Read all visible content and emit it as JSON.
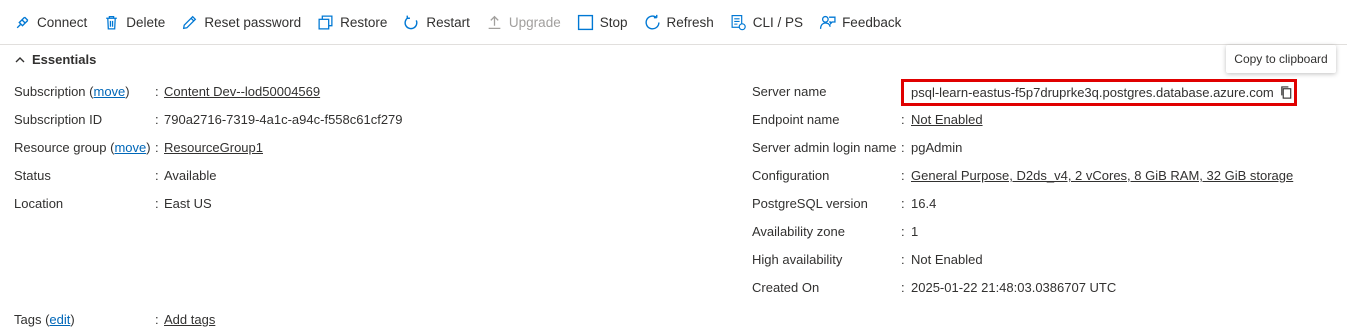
{
  "toolbar": {
    "connect": "Connect",
    "delete": "Delete",
    "reset_password": "Reset password",
    "restore": "Restore",
    "restart": "Restart",
    "upgrade": "Upgrade",
    "stop": "Stop",
    "refresh": "Refresh",
    "cli_ps": "CLI / PS",
    "feedback": "Feedback"
  },
  "essentials": {
    "title": "Essentials"
  },
  "tooltip": "Copy to clipboard",
  "left": {
    "subscription_label": "Subscription (",
    "subscription_move": "move",
    "subscription_close": ")",
    "subscription_value": "Content Dev--lod50004569",
    "subscription_id_label": "Subscription ID",
    "subscription_id_value": "790a2716-7319-4a1c-a94c-f558c61cf279",
    "resource_group_label": "Resource group (",
    "resource_group_move": "move",
    "resource_group_close": ")",
    "resource_group_value": "ResourceGroup1",
    "status_label": "Status",
    "status_value": "Available",
    "location_label": "Location",
    "location_value": "East US",
    "tags_label": "Tags (",
    "tags_edit": "edit",
    "tags_close": ")",
    "tags_value": "Add tags"
  },
  "right": {
    "server_name_label": "Server name",
    "server_name_value": "psql-learn-eastus-f5p7druprke3q.postgres.database.azure.com",
    "endpoint_label": "Endpoint name",
    "endpoint_value": "Not Enabled",
    "admin_label": "Server admin login name",
    "admin_value": "pgAdmin",
    "config_label": "Configuration",
    "config_value": "General Purpose, D2ds_v4, 2 vCores, 8 GiB RAM, 32 GiB storage",
    "pg_version_label": "PostgreSQL version",
    "pg_version_value": "16.4",
    "az_label": "Availability zone",
    "az_value": "1",
    "ha_label": "High availability",
    "ha_value": "Not Enabled",
    "created_label": "Created On",
    "created_value": "2025-01-22 21:48:03.0386707 UTC"
  },
  "colon": ":",
  "colors": {
    "link": "#0067b8",
    "icon": "#0078d4",
    "highlight": "#e00000",
    "text": "#323130",
    "disabled": "#a19f9d"
  },
  "icons": [
    "plug-icon",
    "trash-icon",
    "pencil-icon",
    "restore-icon",
    "restart-icon",
    "upload-icon",
    "stop-icon",
    "refresh-icon",
    "cli-icon",
    "feedback-icon",
    "chevron-up-icon",
    "copy-icon"
  ]
}
